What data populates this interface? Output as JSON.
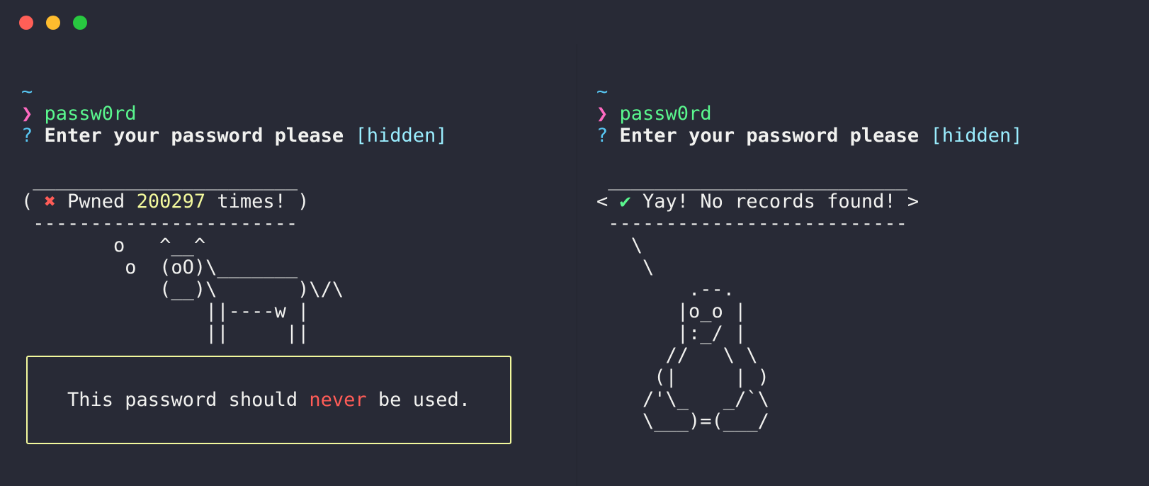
{
  "window": {
    "controls": [
      {
        "name": "close",
        "color": "#ff5f57"
      },
      {
        "name": "minimize",
        "color": "#febc2e"
      },
      {
        "name": "maximize",
        "color": "#28c840"
      }
    ]
  },
  "colors": {
    "background": "#282a36",
    "prompt_cwd": "#58c7f3",
    "prompt_arrow": "#ff6ac1",
    "command": "#5af78e",
    "error": "#ff5c57",
    "highlight": "#f3f99d",
    "success": "#5af78e"
  },
  "left": {
    "cwd": "~",
    "arrow": "❯",
    "command": "passw0rd",
    "question_mark": "?",
    "question": "Enter your password please",
    "hint": "[hidden]",
    "bubble_top": " _______________________",
    "bubble_open": "( ",
    "bubble_icon": "✖",
    "bubble_text1": " Pwned ",
    "bubble_count": "200297",
    "bubble_text2": " times! )",
    "bubble_bottom": " -----------------------",
    "art": [
      "        o   ^__^",
      "         o  (oO)\\_______",
      "            (__)\\       )\\/\\",
      "                ||----w |",
      "                ||     ||"
    ],
    "warning": {
      "before": "This password should ",
      "emph": "never",
      "after": " be used."
    }
  },
  "right": {
    "cwd": "~",
    "arrow": "❯",
    "command": "passw0rd",
    "question_mark": "?",
    "question": "Enter your password please",
    "hint": "[hidden]",
    "bubble_top": " __________________________",
    "bubble_open": "< ",
    "bubble_icon": "✔",
    "bubble_text": " Yay! No records found! >",
    "bubble_bottom": " --------------------------",
    "art": [
      "   \\",
      "    \\",
      "        .--.",
      "       |o_o |",
      "       |:_/ |",
      "      //   \\ \\",
      "     (|     | )",
      "    /'\\_   _/`\\",
      "    \\___)=(___/"
    ]
  }
}
